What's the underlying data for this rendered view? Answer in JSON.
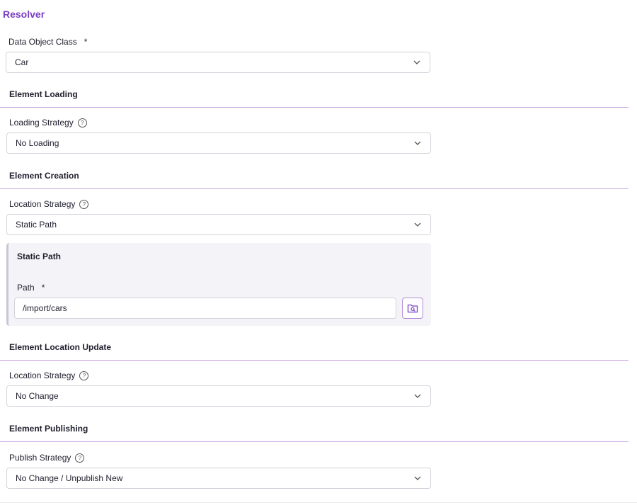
{
  "title": "Resolver",
  "data_object_class": {
    "label": "Data Object Class",
    "required": "*",
    "value": "Car"
  },
  "sections": {
    "loading": {
      "heading": "Element Loading",
      "field_label": "Loading Strategy",
      "value": "No Loading"
    },
    "creation": {
      "heading": "Element Creation",
      "field_label": "Location Strategy",
      "value": "Static Path",
      "static_path": {
        "heading": "Static Path",
        "path_label": "Path",
        "required": "*",
        "path_value": "/import/cars"
      }
    },
    "location_update": {
      "heading": "Element Location Update",
      "field_label": "Location Strategy",
      "value": "No Change"
    },
    "publishing": {
      "heading": "Element Publishing",
      "field_label": "Publish Strategy",
      "value": "No Change / Unpublish New"
    }
  },
  "help_symbol": "?",
  "colors": {
    "accent": "#7a3fc4",
    "rule": "#c9a6e0",
    "panel_bg": "#f4f3f7"
  },
  "icons": {
    "help": "help-icon",
    "dropdown": "chevron-down-icon",
    "folder_search": "folder-search-icon"
  }
}
